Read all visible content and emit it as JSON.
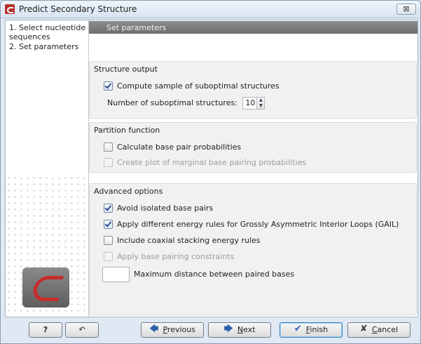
{
  "window": {
    "title": "Predict Secondary Structure",
    "close_glyph": "⊠"
  },
  "steps": [
    {
      "num": "1.",
      "label": "Select nucleotide sequences"
    },
    {
      "num": "2.",
      "label": "Set parameters"
    }
  ],
  "header": {
    "title": "Set parameters"
  },
  "structure_output": {
    "title": "Structure output",
    "compute_sample": {
      "label": "Compute sample of suboptimal structures",
      "checked": true
    },
    "num_suboptimal": {
      "label": "Number of suboptimal structures:",
      "value": "10"
    }
  },
  "partition_function": {
    "title": "Partition function",
    "calc_base_pair": {
      "label": "Calculate base pair probabilities",
      "checked": false
    },
    "create_plot": {
      "label": "Create plot of marginal base pairing probabilities",
      "checked": false,
      "enabled": false
    }
  },
  "advanced_options": {
    "title": "Advanced options",
    "avoid_isolated": {
      "label": "Avoid isolated base pairs",
      "checked": true
    },
    "gail": {
      "label": "Apply different energy rules for Grossly Asymmetric Interior Loops (GAIL)",
      "checked": true
    },
    "coaxial": {
      "label": "Include coaxial stacking energy rules",
      "checked": false
    },
    "constraints": {
      "label": "Apply base pairing constraints",
      "checked": false,
      "enabled": false
    },
    "max_distance": {
      "label": "Maximum distance between paired bases",
      "value": ""
    }
  },
  "buttons": {
    "help": "?",
    "reset_icon": "↶",
    "previous_pre": "",
    "previous_u": "P",
    "previous_post": "revious",
    "next_pre": "",
    "next_u": "N",
    "next_post": "ext",
    "finish_pre": "",
    "finish_u": "F",
    "finish_post": "inish",
    "cancel_pre": "",
    "cancel_u": "C",
    "cancel_post": "ancel"
  },
  "icons": {
    "previous": "🡄",
    "next": "🡆",
    "finish": "✔",
    "cancel": "✘"
  }
}
